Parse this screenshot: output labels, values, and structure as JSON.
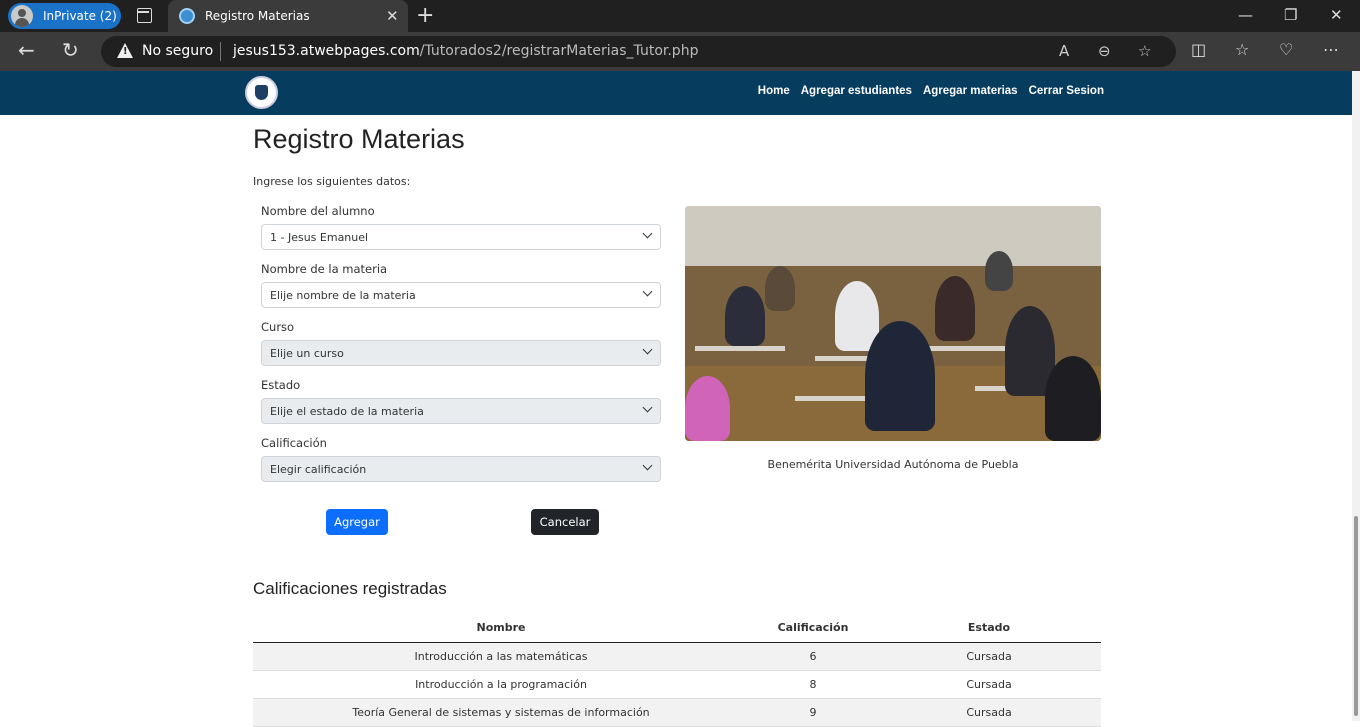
{
  "browser": {
    "inprivate_label": "InPrivate (2)",
    "tab_title": "Registro Materias",
    "security_label": "No seguro",
    "url_domain": "jesus153.atwebpages.com",
    "url_path": "/Tutorados2/registrarMaterias_Tutor.php"
  },
  "nav": {
    "links": [
      "Home",
      "Agregar estudiantes",
      "Agregar materias",
      "Cerrar Sesion"
    ]
  },
  "page": {
    "title": "Registro Materias",
    "intro": "Ingrese los siguientes datos:"
  },
  "form": {
    "alumno_label": "Nombre del alumno",
    "alumno_value": "1 - Jesus Emanuel",
    "materia_label": "Nombre de la materia",
    "materia_value": "Elije nombre de la materia",
    "curso_label": "Curso",
    "curso_value": "Elije un curso",
    "estado_label": "Estado",
    "estado_value": "Elije el estado de la materia",
    "calificacion_label": "Calificación",
    "calificacion_value": "Elegir calificación",
    "submit_label": "Agregar",
    "cancel_label": "Cancelar"
  },
  "image": {
    "caption": "Benemérita Universidad Autónoma de Puebla"
  },
  "grades": {
    "heading": "Calificaciones registradas",
    "columns": [
      "Nombre",
      "Calificación",
      "Estado"
    ],
    "rows": [
      [
        "Introducción a las matemáticas",
        "6",
        "Cursada"
      ],
      [
        "Introducción a la programación",
        "8",
        "Cursada"
      ],
      [
        "Teoría General de sistemas y sistemas de información",
        "9",
        "Cursada"
      ]
    ]
  },
  "colors": {
    "navbar": "#063c5e",
    "primary_button": "#0d6efd",
    "dark_button": "#212529"
  }
}
